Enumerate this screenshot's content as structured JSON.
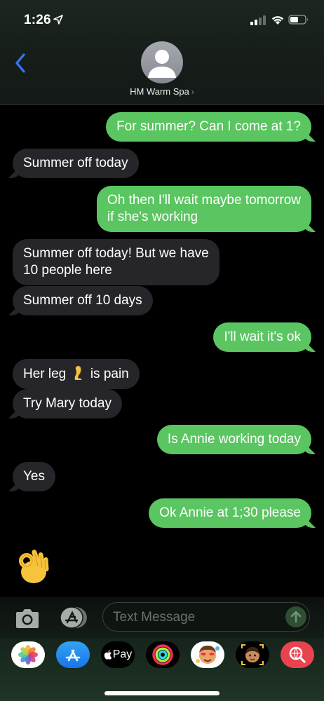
{
  "status_bar": {
    "time": "1:26",
    "icons": [
      "location-arrow-icon",
      "cellular-signal-icon",
      "wifi-icon",
      "battery-icon"
    ]
  },
  "header": {
    "back_icon": "chevron-left-icon",
    "contact_name": "HM Warm Spa",
    "contact_chevron": "›",
    "avatar_icon": "person-silhouette-icon",
    "accent_color": "#3478f6"
  },
  "messages": [
    {
      "from": "me",
      "text": "For summer? Can I come at 1?"
    },
    {
      "from": "them",
      "text": "Summer off today"
    },
    {
      "from": "me",
      "lines": [
        "Oh then I'll wait maybe tomorrow",
        "if she's working"
      ]
    },
    {
      "from": "them",
      "lines": [
        "Summer off today! But we have",
        "10 people here"
      ]
    },
    {
      "from": "them",
      "text": "Summer off 10 days"
    },
    {
      "from": "me",
      "text": "I'll wait it's ok"
    },
    {
      "from": "them",
      "text_before": "Her leg",
      "emoji": "leg-emoji",
      "text_after": "is pain"
    },
    {
      "from": "them",
      "text": "Try Mary today"
    },
    {
      "from": "me",
      "text": "Is Annie working today"
    },
    {
      "from": "them",
      "text": "Yes"
    },
    {
      "from": "me",
      "text": "Ok Annie at 1;30 please"
    },
    {
      "from": "them",
      "emoji": "ok-hand-emoji"
    }
  ],
  "colors": {
    "outgoing_bubble": "#5ac561",
    "incoming_bubble": "#26262a"
  },
  "input_bar": {
    "camera_icon": "camera-icon",
    "apps_icon": "app-store-icon",
    "placeholder": "Text Message",
    "send_icon": "arrow-up-icon"
  },
  "app_drawer": {
    "apps": [
      {
        "name": "photos-app-icon"
      },
      {
        "name": "app-store-app-icon"
      },
      {
        "name": "apple-pay-app-icon",
        "label": "Pay"
      },
      {
        "name": "activity-app-icon"
      },
      {
        "name": "memoji-stickers-app-icon"
      },
      {
        "name": "animoji-app-icon"
      },
      {
        "name": "web-image-search-app-icon"
      }
    ]
  }
}
